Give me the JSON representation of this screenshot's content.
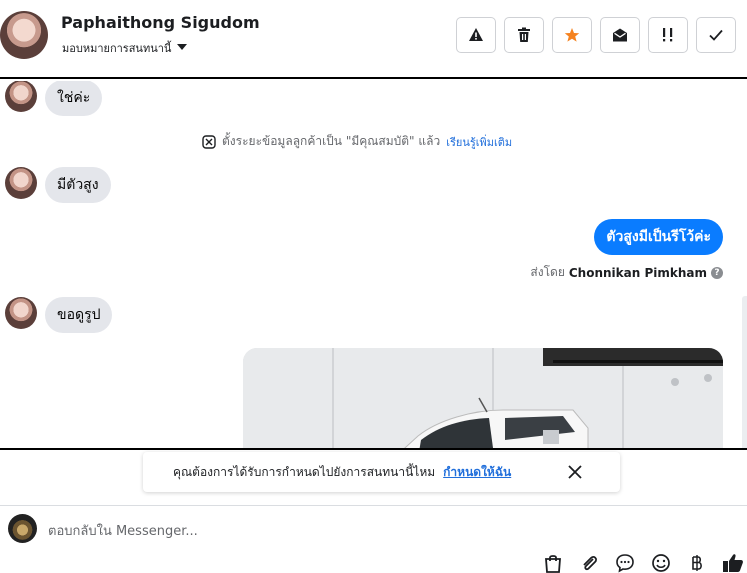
{
  "header": {
    "name": "Paphaithong Sigudom",
    "assign_label": "มอบหมายการสนทนานี้",
    "toolbar": [
      {
        "icon": "warning-icon",
        "glyph": "⚠"
      },
      {
        "icon": "trash-icon",
        "glyph": "🗑"
      },
      {
        "icon": "star-icon",
        "glyph": "★",
        "color": "#f5821f"
      },
      {
        "icon": "open-envelope-icon",
        "glyph": "✉"
      },
      {
        "icon": "follow-up-icon",
        "glyph": "!!"
      },
      {
        "icon": "checkmark-icon",
        "glyph": "✓"
      }
    ]
  },
  "messages": {
    "incoming_1": "ใช่ค่ะ",
    "system_note": "ตั้งระยะข้อมูลลูกค้าเป็น \"มีคุณสมบัติ\" แล้ว",
    "system_link": "เรียนรู้เพิ่มเติม",
    "incoming_2": "มีตัวสูง",
    "outgoing_1": "ตัวสูงมีเป็นรีโว้ค่ะ",
    "sent_by_prefix": "ส่งโดย",
    "sent_by_name": "Chonnikan Pimkham",
    "incoming_3": "ขอดูรูป"
  },
  "reminder": {
    "text": "คุณต้องการได้รับการกำหนดไปยังการสนทนานี้ไหม",
    "link": "กำหนดให้ฉัน"
  },
  "composer": {
    "placeholder": "ตอบกลับใน Messenger..."
  },
  "colors": {
    "accent": "#0a7cff",
    "link": "#216fdb",
    "incoming_bubble": "#e4e6eb",
    "star": "#f5821f"
  },
  "composer_tools": [
    "shopping-bag-icon",
    "paperclip-icon",
    "saved-reply-icon",
    "emoji-icon",
    "baht-payment-icon",
    "thumbs-up-icon"
  ]
}
